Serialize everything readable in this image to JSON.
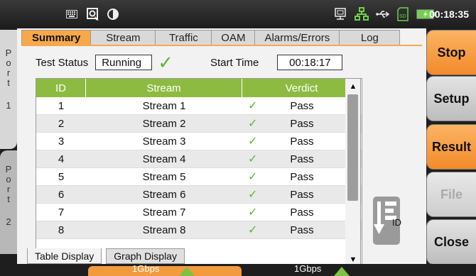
{
  "topbar": {
    "icons": [
      "keyboard-icon",
      "screenshot-icon",
      "contrast-icon",
      "ethernet-icon",
      "network-icon",
      "usb-icon",
      "sd-card-icon",
      "battery-icon"
    ],
    "clock": "00:18:35"
  },
  "ports": {
    "port1": [
      "P",
      "o",
      "r",
      "t",
      "1"
    ],
    "port2": [
      "P",
      "o",
      "r",
      "t",
      "2"
    ]
  },
  "tabs": [
    "Summary",
    "Stream",
    "Traffic",
    "OAM",
    "Alarms/Errors",
    "Log"
  ],
  "active_tab": "Summary",
  "status": {
    "test_status_label": "Test Status",
    "test_status_value": "Running",
    "start_time_label": "Start Time",
    "start_time_value": "00:18:17"
  },
  "table": {
    "headers": [
      "ID",
      "Stream",
      "Verdict"
    ],
    "rows": [
      {
        "id": "1",
        "stream": "Stream 1",
        "verdict": "Pass"
      },
      {
        "id": "2",
        "stream": "Stream 2",
        "verdict": "Pass"
      },
      {
        "id": "3",
        "stream": "Stream 3",
        "verdict": "Pass"
      },
      {
        "id": "4",
        "stream": "Stream 4",
        "verdict": "Pass"
      },
      {
        "id": "5",
        "stream": "Stream 5",
        "verdict": "Pass"
      },
      {
        "id": "6",
        "stream": "Stream 6",
        "verdict": "Pass"
      },
      {
        "id": "7",
        "stream": "Stream 7",
        "verdict": "Pass"
      },
      {
        "id": "8",
        "stream": "Stream 8",
        "verdict": "Pass"
      }
    ]
  },
  "bottom_tabs": [
    "Table Display",
    "Graph Display"
  ],
  "sort_icon_label": "ID",
  "right_buttons": [
    "Stop",
    "Setup",
    "Result",
    "File",
    "Close"
  ],
  "bottom_strip": {
    "speed1": "1Gbps",
    "speed2": "1Gbps"
  },
  "colors": {
    "accent_orange": "#f7a84b",
    "header_green": "#8dbb41",
    "check_green": "#59b830"
  }
}
